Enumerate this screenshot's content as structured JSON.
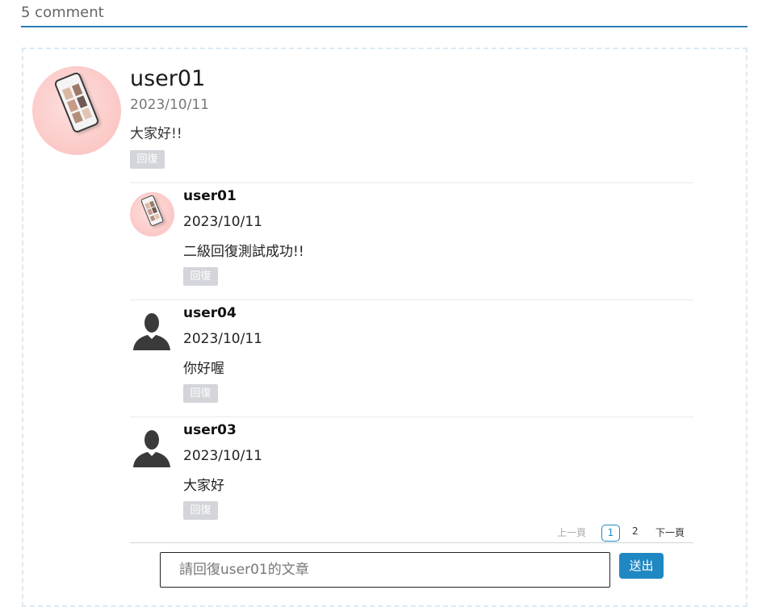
{
  "header": {
    "comment_count_label": "5 comment"
  },
  "main_comment": {
    "author": "user01",
    "date": "2023/10/11",
    "text": "大家好!!",
    "reply_label": "回復",
    "avatar": "phone-photo-avatar"
  },
  "replies": [
    {
      "author": "user01",
      "date": "2023/10/11",
      "text": "二級回復測試成功!!",
      "reply_label": "回復",
      "avatar": "phone-photo-avatar"
    },
    {
      "author": "user04",
      "date": "2023/10/11",
      "text": "你好喔",
      "reply_label": "回復",
      "avatar": "person-silhouette-icon"
    },
    {
      "author": "user03",
      "date": "2023/10/11",
      "text": "大家好",
      "reply_label": "回復",
      "avatar": "person-silhouette-icon"
    }
  ],
  "pagination": {
    "prev_label": "上一頁",
    "current_page": "1",
    "page_2": "2",
    "next_label": "下一頁"
  },
  "reply_form": {
    "placeholder": "請回復user01的文章",
    "submit_label": "送出"
  },
  "colors": {
    "accent": "#1f88c3",
    "reply_button_bg": "#d3d5da",
    "panel_border": "#dce9f3"
  }
}
